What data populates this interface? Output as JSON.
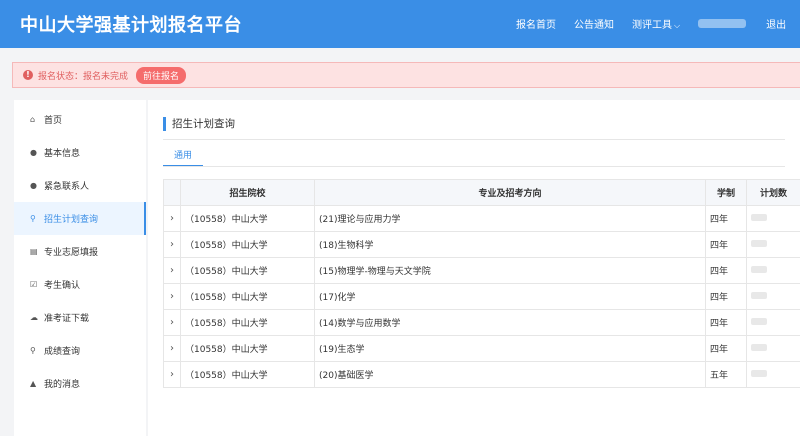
{
  "header": {
    "title": "中山大学强基计划报名平台",
    "nav": [
      "报名首页",
      "公告通知",
      "测评工具"
    ],
    "logout": "退出",
    "caret_icon": "chevron-down-icon"
  },
  "alert": {
    "text": "报名状态：报名未完成",
    "button": "前往报名",
    "color": "#f56c6c"
  },
  "sidebar": {
    "items": [
      {
        "label": "首页",
        "icon": "home-icon"
      },
      {
        "label": "基本信息",
        "icon": "user-icon"
      },
      {
        "label": "紧急联系人",
        "icon": "contact-icon"
      },
      {
        "label": "招生计划查询",
        "icon": "search-icon",
        "active": true
      },
      {
        "label": "专业志愿填报",
        "icon": "form-icon"
      },
      {
        "label": "考生确认",
        "icon": "check-icon"
      },
      {
        "label": "准考证下载",
        "icon": "download-icon"
      },
      {
        "label": "成绩查询",
        "icon": "search-icon"
      },
      {
        "label": "我的消息",
        "icon": "bell-icon"
      }
    ]
  },
  "main": {
    "title": "招生计划查询",
    "tab": "通用",
    "table": {
      "headers": [
        "招生院校",
        "专业及招考方向",
        "学制",
        "计划数"
      ],
      "rows": [
        [
          "（10558）中山大学",
          "(21)理论与应用力学",
          "四年"
        ],
        [
          "（10558）中山大学",
          "(18)生物科学",
          "四年"
        ],
        [
          "（10558）中山大学",
          "(15)物理学-物理与天文学院",
          "四年"
        ],
        [
          "（10558）中山大学",
          "(17)化学",
          "四年"
        ],
        [
          "（10558）中山大学",
          "(14)数学与应用数学",
          "四年"
        ],
        [
          "（10558）中山大学",
          "(19)生态学",
          "四年"
        ],
        [
          "（10558）中山大学",
          "(20)基础医学",
          "五年"
        ]
      ]
    }
  },
  "colors": {
    "primary": "#3a8ee6",
    "alert_bg": "#fde2e2",
    "alert_text": "#e05f5f"
  }
}
